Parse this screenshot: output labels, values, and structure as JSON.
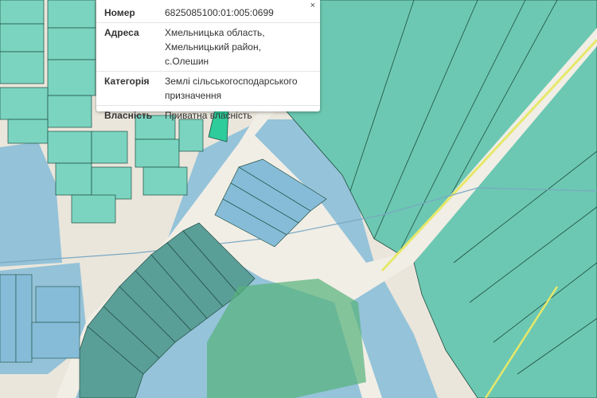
{
  "popup": {
    "close_label": "×",
    "rows": [
      {
        "key": "Номер",
        "value_lines": [
          "6825085100:01:005:0699"
        ]
      },
      {
        "key": "Адреса",
        "value_lines": [
          "Хмельницька область,",
          "Хмельницький район, с.Олешин"
        ]
      },
      {
        "key": "Категорія",
        "value_lines": [
          "Землі сільськогосподарського",
          "призначення"
        ]
      },
      {
        "key": "Власність",
        "value_lines": [
          "Приватна власність"
        ]
      }
    ]
  },
  "colors": {
    "background": "#eae6dc",
    "road": "#f1eee6",
    "parcel_fill": "#6cc8b2",
    "parcel_fill_dark": "#5a9e98",
    "water_zone": "#7fb8d8",
    "selected_parcel": "#2ecc9a",
    "highlight_zone": "#56b27a",
    "parcel_border": "#1e4e40",
    "yellow_line": "#e6e86a"
  }
}
